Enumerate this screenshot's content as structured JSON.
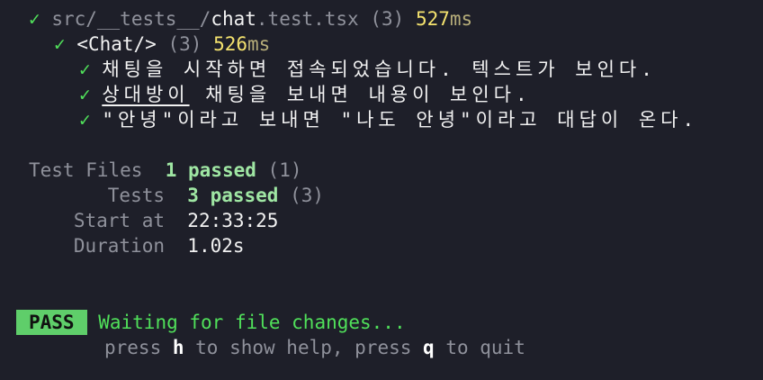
{
  "file_result": {
    "check": "✓",
    "dir": "src/__tests__/",
    "file_name": "chat",
    "file_ext": ".test.tsx",
    "count": "(3)",
    "time_value": "527",
    "time_unit": "ms"
  },
  "suite": {
    "check": "✓",
    "name": "<Chat/>",
    "count": "(3)",
    "time_value": "526",
    "time_unit": "ms"
  },
  "tests": [
    {
      "check": "✓",
      "text": "채팅을 시작하면 접속되었습니다. 텍스트가 보인다."
    },
    {
      "check": "✓",
      "underlined": "상대방이",
      "rest": " 채팅을 보내면 내용이 보인다."
    },
    {
      "check": "✓",
      "text": "\"안녕\"이라고 보내면 \"나도 안녕\"이라고 대답이 온다."
    }
  ],
  "summary": {
    "test_files_label": "Test Files",
    "test_files_passed": "1 passed",
    "test_files_total": "(1)",
    "tests_label": "Tests",
    "tests_passed": "3 passed",
    "tests_total": "(3)",
    "start_label": "Start at",
    "start_value": "22:33:25",
    "duration_label": "Duration",
    "duration_value": "1.02s"
  },
  "status": {
    "badge": "PASS",
    "message": "Waiting for file changes...",
    "help_prefix": "press ",
    "help_key_h": "h",
    "help_mid": " to show help, press ",
    "help_key_q": "q",
    "help_suffix": " to quit"
  },
  "colors": {
    "background": "#1e1f29",
    "pass_green": "#50e05a",
    "badge_bg": "#5fce6a",
    "duration_yellow": "#f4e26e"
  }
}
